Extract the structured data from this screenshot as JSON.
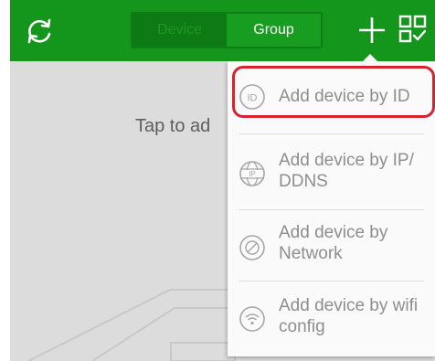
{
  "header": {
    "tabs": [
      {
        "label": "Device",
        "selected": false
      },
      {
        "label": "Group",
        "selected": true
      }
    ],
    "icons": {
      "refresh": "refresh-icon",
      "add": "plus-icon",
      "scan": "qr-scan-icon"
    }
  },
  "content": {
    "hint": "Tap to ad"
  },
  "menu": {
    "items": [
      {
        "label": "Add device by ID",
        "icon": "id-icon"
      },
      {
        "label": "Add device by IP/ DDNS",
        "icon": "globe-ip-icon"
      },
      {
        "label": "Add device by Network",
        "icon": "network-icon"
      },
      {
        "label": "Add device by wifi config",
        "icon": "wifi-icon"
      }
    ]
  },
  "colors": {
    "header": "#14961c",
    "highlight": "#d6232e",
    "menu_text": "#8e8e8e",
    "background": "#dcdcdc"
  }
}
